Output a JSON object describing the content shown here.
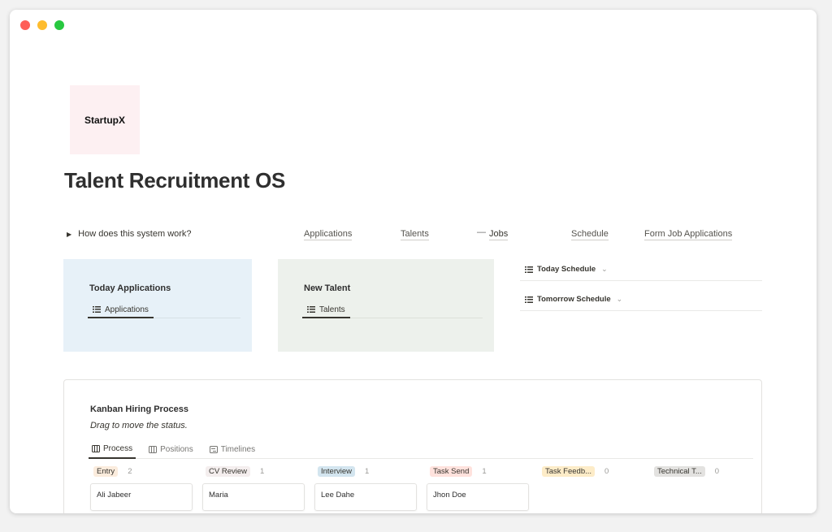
{
  "logo": {
    "text": "StartupX"
  },
  "page": {
    "title": "Talent Recruitment OS"
  },
  "toggle": {
    "label": "How does this system work?"
  },
  "nav": {
    "applications": "Applications",
    "talents": "Talents",
    "jobs_prefix": "—",
    "jobs": "Jobs",
    "schedule": "Schedule",
    "form": "Form Job Applications"
  },
  "cards": {
    "today": {
      "title": "Today Applications",
      "tab": "Applications"
    },
    "new": {
      "title": "New Talent",
      "tab": "Talents"
    }
  },
  "schedule": {
    "today": "Today Schedule",
    "tomorrow": "Tomorrow Schedule",
    "chevron": "⌄"
  },
  "kanban": {
    "title": "Kanban Hiring Process",
    "subtitle": "Drag to move the status.",
    "tabs": [
      "Process",
      "Positions",
      "Timelines"
    ],
    "columns": [
      {
        "label": "Entry",
        "count": "2",
        "color": "#fbecdd",
        "card": "Ali Jabeer"
      },
      {
        "label": "CV Review",
        "count": "1",
        "color": "#f4eeee",
        "card": "Maria"
      },
      {
        "label": "Interview",
        "count": "1",
        "color": "#d3e5ef",
        "card": "Lee Dahe"
      },
      {
        "label": "Task Send",
        "count": "1",
        "color": "#ffe2dd",
        "card": "Jhon Doe"
      },
      {
        "label": "Task Feedb...",
        "count": "0",
        "color": "#fdecc8",
        "card": ""
      },
      {
        "label": "Technical T...",
        "count": "0",
        "color": "#e3e2e0",
        "card": ""
      }
    ]
  }
}
